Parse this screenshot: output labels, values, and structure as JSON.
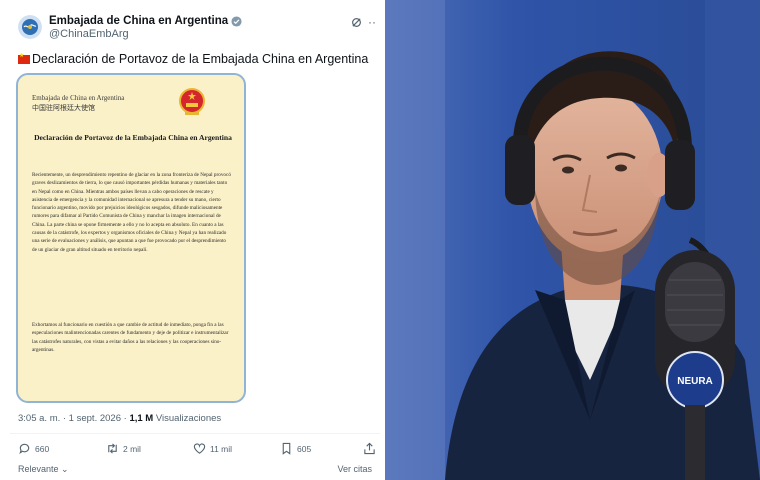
{
  "tweet": {
    "display_name": "Embajada de China en Argentina",
    "handle": "@ChinaEmbArg",
    "text": "Declaración de Portavoz de la Embajada China en Argentina",
    "more_label": "··"
  },
  "document": {
    "header_es": "Embajada de China en Argentina",
    "header_zh": "中国驻阿根廷大使馆",
    "title": "Declaración de Portavoz de la Embajada China en Argentina",
    "paragraph1": "Recientemente, un desprendimiento repentino de glaciar en la zona fronteriza de Nepal provocó graves deslizamientos de tierra, lo que causó importantes pérdidas humanas y materiales tanto en Nepal como en China. Mientras ambos países llevan a cabo operaciones de rescate y asistencia de emergencia y la comunidad internacional se apresura a tender su mano, cierto funcionario argentino, movido por prejuicios ideológicos sesgados, difunde maliciosamente rumores para difamar al Partido Comunista de China y manchar la imagen internacional de China. La parte china se opone firmemente a ello y no lo acepta en absoluto. En cuanto a las causas de la catástrofe, los expertos y organismos oficiales de China y Nepal ya han realizado una serie de evaluaciones y análisis, que apuntan a que fue provocado por el desprendimiento de un glaciar de gran altitud situado en territorio nepalí.",
    "paragraph2": "Exhortamos al funcionario en cuestión a que cambie de actitud de inmediato, ponga fin a las especulaciones malintencionadas carentes de fundamento y deje de politizar e instrumentalizar las catástrofes naturales, con vistas a evitar daños a las relaciones y las cooperaciones sino-argentinas."
  },
  "meta": {
    "time_date": "3:05 a. m. · 1 sept. 2026 ·",
    "views_count": "1,1 M",
    "views_label": "Visualizaciones"
  },
  "actions": {
    "replies": "660",
    "reposts": "2 mil",
    "likes": "11 mil",
    "bookmarks": "605"
  },
  "footer": {
    "sort_label": "Relevante",
    "see_quotes": "Ver citas"
  },
  "photo": {
    "mic_brand": "NEURA"
  },
  "colors": {
    "doc_background": "#fbf1c8",
    "doc_border": "#8fb4d6",
    "verified_gold": "#d6a22a",
    "photo_background": "#2b4d95"
  }
}
